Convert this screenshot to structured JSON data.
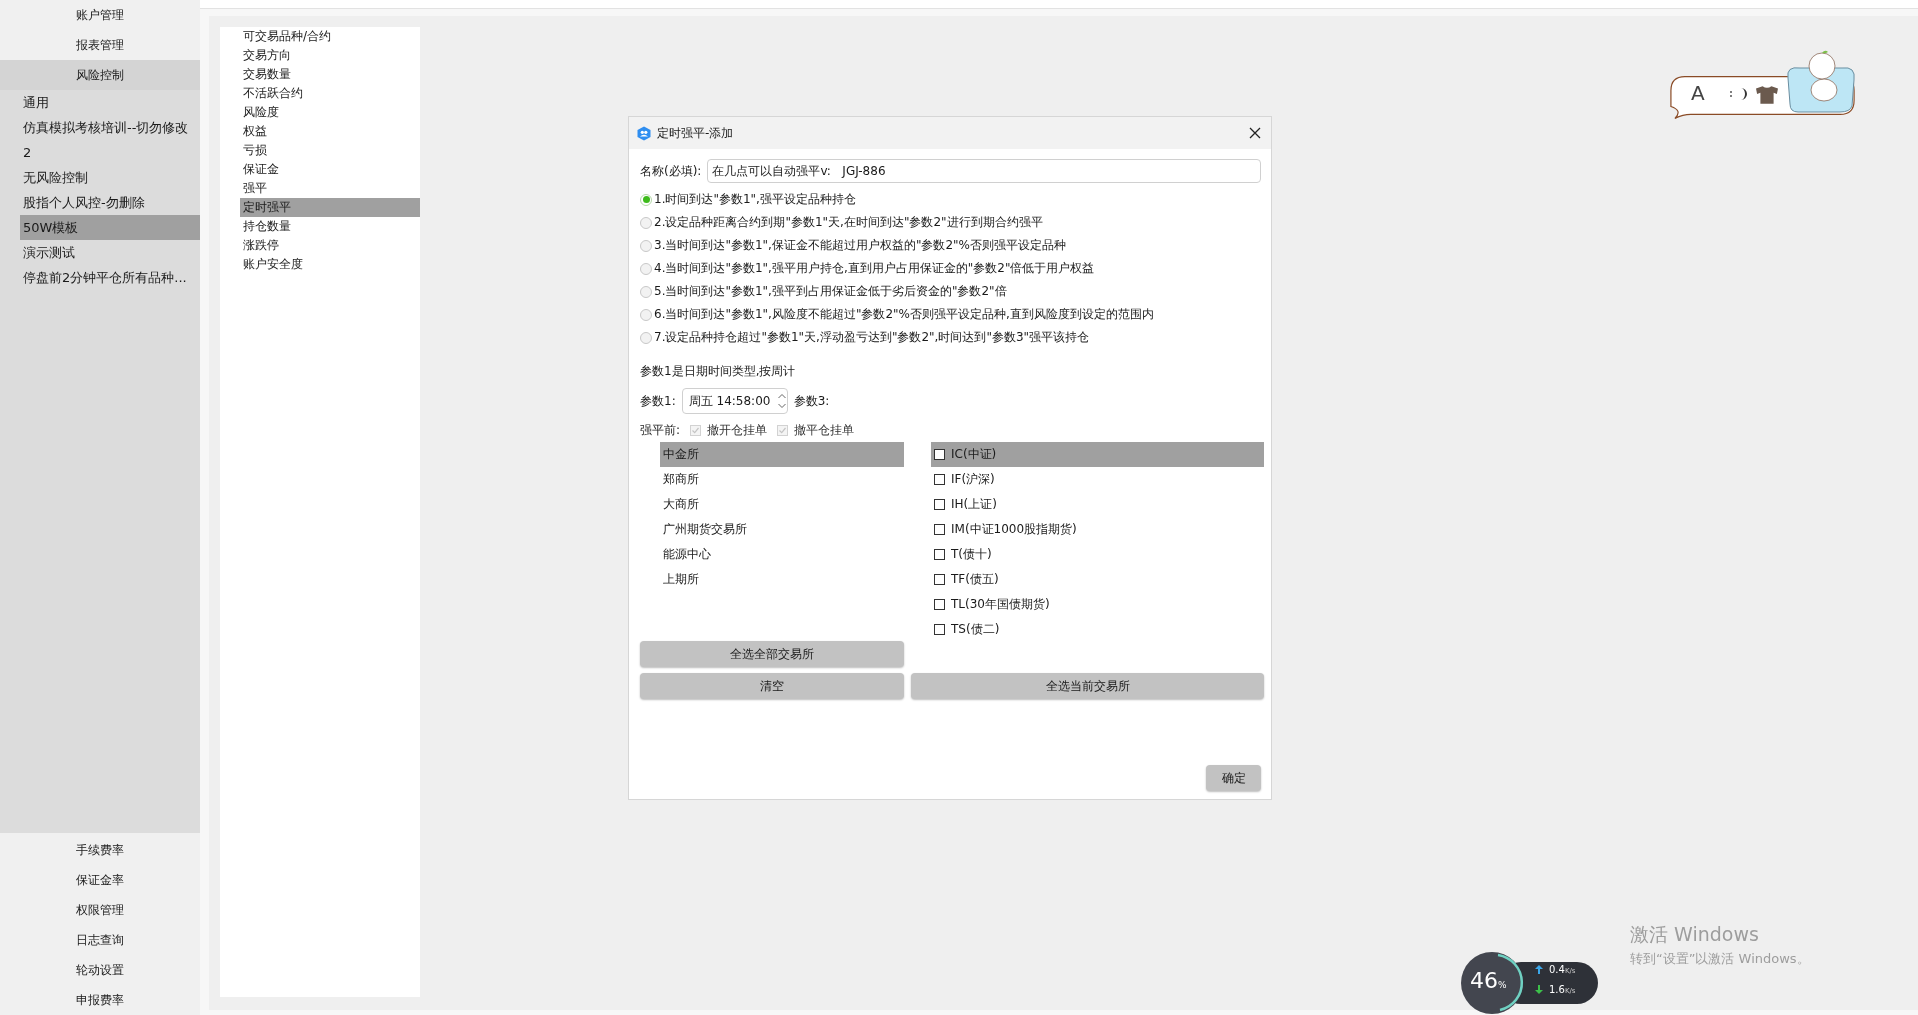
{
  "sidebar": {
    "top_items": [
      {
        "label": "账户管理",
        "selected": false
      },
      {
        "label": "报表管理",
        "selected": false
      },
      {
        "label": "风险控制",
        "selected": true
      }
    ],
    "templates": [
      {
        "label": "通用",
        "selected": false
      },
      {
        "label": "仿真模拟考核培训--切勿修改",
        "selected": false
      },
      {
        "label": "2",
        "selected": false
      },
      {
        "label": "无风险控制",
        "selected": false
      },
      {
        "label": "股指个人风控-勿删除",
        "selected": false
      },
      {
        "label": "50W模板",
        "selected": true
      },
      {
        "label": "演示测试",
        "selected": false
      },
      {
        "label": "停盘前2分钟平仓所有品种...",
        "selected": false
      }
    ],
    "bottom_items": [
      {
        "label": "手续费率",
        "selected": false
      },
      {
        "label": "保证金率",
        "selected": false
      },
      {
        "label": "权限管理",
        "selected": false
      },
      {
        "label": "日志查询",
        "selected": false
      },
      {
        "label": "轮动设置",
        "selected": false
      },
      {
        "label": "申报费率",
        "selected": false
      }
    ]
  },
  "rule_types": [
    {
      "label": "可交易品种/合约",
      "selected": false
    },
    {
      "label": "交易方向",
      "selected": false
    },
    {
      "label": "交易数量",
      "selected": false
    },
    {
      "label": "不活跃合约",
      "selected": false
    },
    {
      "label": "风险度",
      "selected": false
    },
    {
      "label": "权益",
      "selected": false
    },
    {
      "label": "亏损",
      "selected": false
    },
    {
      "label": "保证金",
      "selected": false
    },
    {
      "label": "强平",
      "selected": false
    },
    {
      "label": "定时强平",
      "selected": true
    },
    {
      "label": "持仓数量",
      "selected": false
    },
    {
      "label": "涨跌停",
      "selected": false
    },
    {
      "label": "账户安全度",
      "selected": false
    }
  ],
  "dialog": {
    "title": "定时强平-添加",
    "name_label": "名称(必填):",
    "name_value": "在几点可以自动强平v:   JGJ-886",
    "options": [
      {
        "label": "1.时间到达\"参数1\",强平设定品种持仓",
        "selected": true
      },
      {
        "label": "2.设定品种距离合约到期\"参数1\"天,在时间到达\"参数2\"进行到期合约强平",
        "selected": false
      },
      {
        "label": "3.当时间到达\"参数1\",保证金不能超过用户权益的\"参数2\"%否则强平设定品种",
        "selected": false
      },
      {
        "label": "4.当时间到达\"参数1\",强平用户持仓,直到用户占用保证金的\"参数2\"倍低于用户权益",
        "selected": false
      },
      {
        "label": "5.当时间到达\"参数1\",强平到占用保证金低于劣后资金的\"参数2\"倍",
        "selected": false
      },
      {
        "label": "6.当时间到达\"参数1\",风险度不能超过\"参数2\"%否则强平设定品种,直到风险度到设定的范围内",
        "selected": false
      },
      {
        "label": "7.设定品种持仓超过\"参数1\"天,浮动盈亏达到\"参数2\",时间达到\"参数3\"强平该持仓",
        "selected": false
      }
    ],
    "param_hint": "参数1是日期时间类型,按周计",
    "param1_label": "参数1:",
    "param1_value": "周五 14:58:00",
    "param3_label": "参数3:",
    "before_label": "强平前:",
    "before_checks": [
      {
        "label": "撤开仓挂单",
        "checked": true,
        "disabled": true
      },
      {
        "label": "撤平仓挂单",
        "checked": true,
        "disabled": true
      }
    ],
    "exchanges": [
      {
        "label": "中金所",
        "selected": true
      },
      {
        "label": "郑商所",
        "selected": false
      },
      {
        "label": "大商所",
        "selected": false
      },
      {
        "label": "广州期货交易所",
        "selected": false
      },
      {
        "label": "能源中心",
        "selected": false
      },
      {
        "label": "上期所",
        "selected": false
      }
    ],
    "products": [
      {
        "label": "IC(中证)",
        "checked": false,
        "selected": true
      },
      {
        "label": "IF(沪深)",
        "checked": false,
        "selected": false
      },
      {
        "label": "IH(上证)",
        "checked": false,
        "selected": false
      },
      {
        "label": "IM(中证1000股指期货)",
        "checked": false,
        "selected": false
      },
      {
        "label": "T(债十)",
        "checked": false,
        "selected": false
      },
      {
        "label": "TF(债五)",
        "checked": false,
        "selected": false
      },
      {
        "label": "TL(30年国债期货)",
        "checked": false,
        "selected": false
      },
      {
        "label": "TS(债二)",
        "checked": false,
        "selected": false
      }
    ],
    "select_all_exchanges": "全选全部交易所",
    "clear": "清空",
    "select_current_exchange": "全选当前交易所",
    "ok": "确定"
  },
  "bubble": {
    "letter": "A"
  },
  "network_meter": {
    "percent": "46",
    "percent_unit": "%",
    "rates": [
      {
        "kind": "up",
        "value": "0.4",
        "unit": "K/s"
      },
      {
        "kind": "down",
        "value": "1.6",
        "unit": "K/s"
      }
    ]
  },
  "activation": {
    "title": "激活 Windows",
    "text": "转到“设置”以激活 Windows。"
  }
}
